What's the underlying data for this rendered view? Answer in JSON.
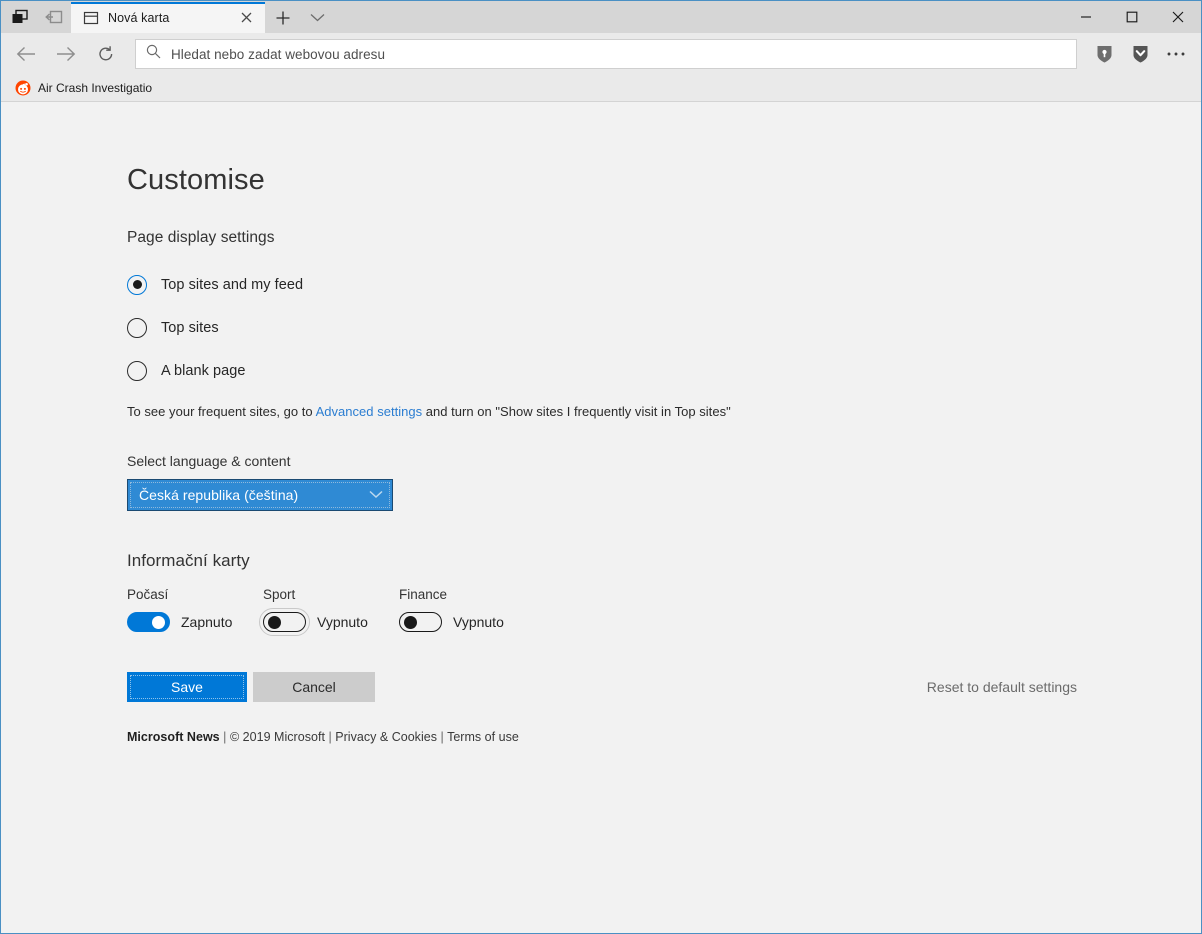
{
  "window": {
    "title": "Nová karta",
    "controls": {
      "minimize": "Minimise",
      "maximize": "Maximise",
      "close": "Close"
    },
    "system_icons": {
      "set_tabs_aside": "set-tabs-aside-icon",
      "tabs_you_set_aside": "tabs-you-have-set-aside-icon"
    }
  },
  "tabbar": {
    "active_tab": {
      "title": "Nová karta",
      "favicon": "new-tab-page-icon",
      "close_label": "Close tab"
    },
    "new_tab_label": "New tab",
    "tab_menu_label": "Tab options"
  },
  "navbar": {
    "back_label": "Back",
    "forward_label": "Forward",
    "refresh_label": "Refresh",
    "address": {
      "placeholder": "Hledat nebo zadat webovou adresu",
      "value": "",
      "search_icon": "search-icon"
    },
    "extensions": [
      {
        "name": "lastpass-extension",
        "icon": "shield-key-icon"
      },
      {
        "name": "pocket-extension",
        "icon": "shield-chevron-icon"
      }
    ],
    "more_label": "Settings and more"
  },
  "favorites_bar": {
    "items": [
      {
        "label": "Air Crash Investigatio",
        "favicon": "reddit-icon"
      }
    ]
  },
  "main": {
    "title": "Customise",
    "page_display": {
      "label": "Page display settings",
      "options": [
        {
          "label": "Top sites and my feed",
          "selected": true
        },
        {
          "label": "Top sites",
          "selected": false
        },
        {
          "label": "A blank page",
          "selected": false
        }
      ],
      "hint_before": "To see your frequent sites, go to ",
      "hint_link": "Advanced settings",
      "hint_after": " and turn on \"Show sites I frequently visit in Top sites\""
    },
    "language": {
      "label": "Select language & content",
      "selected": "Česká republika (čeština)",
      "chevron": "chevron-down-icon"
    },
    "cards": {
      "heading": "Informační karty",
      "items": [
        {
          "caption": "Počasí",
          "state": "Zapnuto",
          "on": true,
          "focused": false
        },
        {
          "caption": "Sport",
          "state": "Vypnuto",
          "on": false,
          "focused": true
        },
        {
          "caption": "Finance",
          "state": "Vypnuto",
          "on": false,
          "focused": false
        }
      ]
    },
    "actions": {
      "save": "Save",
      "cancel": "Cancel",
      "reset": "Reset to default settings"
    },
    "footer": {
      "brand": "Microsoft News",
      "copyright": "© 2019 Microsoft",
      "privacy": "Privacy & Cookies",
      "terms": "Terms of use",
      "separator": "|"
    }
  },
  "colors": {
    "accent": "#0078d7",
    "link": "#2b7dd1",
    "select_fill": "#2f8ad4",
    "page_bg": "#f2f2f2",
    "chrome_bg": "#eaeaea",
    "titlebar_bg": "#d6d6d6",
    "reddit_orange": "#ff4500"
  }
}
